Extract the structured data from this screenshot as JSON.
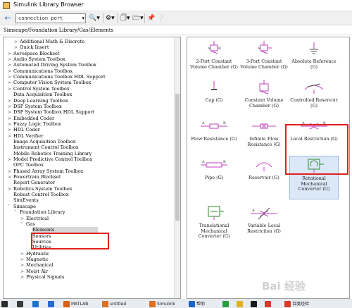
{
  "window": {
    "title": "Simulink Library Browser",
    "icon": "simulink-icon"
  },
  "toolbar": {
    "search_value": "connection port",
    "back_icon": "back-arrow-icon",
    "search_dropdown_icon": "chevron-down-icon",
    "find_icon": "binoculars-icon",
    "options_icon": "gear-icon",
    "new_icon": "new-model-icon",
    "open_icon": "folder-open-icon",
    "pin_icon": "pin-icon",
    "help_icon": "help-icon"
  },
  "breadcrumb": "Simscape/Foundation Library/Gas/Elements",
  "tree": [
    {
      "label": "Additional Math & Discrete",
      "indent": 1,
      "arrow": ">"
    },
    {
      "label": "Quick Insert",
      "indent": 1,
      "arrow": ">"
    },
    {
      "label": "Aerospace Blockset",
      "indent": 0,
      "arrow": ">"
    },
    {
      "label": "Audio System Toolbox",
      "indent": 0,
      "arrow": ">"
    },
    {
      "label": "Automated Driving System Toolbox",
      "indent": 0,
      "arrow": ">"
    },
    {
      "label": "Communications Toolbox",
      "indent": 0,
      "arrow": ">"
    },
    {
      "label": "Communications Toolbox HDL Support",
      "indent": 0,
      "arrow": ">"
    },
    {
      "label": "Computer Vision System Toolbox",
      "indent": 0,
      "arrow": ">"
    },
    {
      "label": "Control System Toolbox",
      "indent": 0,
      "arrow": ">"
    },
    {
      "label": "Data Acquisition Toolbox",
      "indent": 0,
      "arrow": ""
    },
    {
      "label": "Deep Learning Toolbox",
      "indent": 0,
      "arrow": ">"
    },
    {
      "label": "DSP System Toolbox",
      "indent": 0,
      "arrow": ">"
    },
    {
      "label": "DSP System Toolbox HDL Support",
      "indent": 0,
      "arrow": ">"
    },
    {
      "label": "Embedded Coder",
      "indent": 0,
      "arrow": ">"
    },
    {
      "label": "Fuzzy Logic Toolbox",
      "indent": 0,
      "arrow": ">"
    },
    {
      "label": "HDL Coder",
      "indent": 0,
      "arrow": ">"
    },
    {
      "label": "HDL Verifier",
      "indent": 0,
      "arrow": ">"
    },
    {
      "label": "Image Acquisition Toolbox",
      "indent": 0,
      "arrow": ""
    },
    {
      "label": "Instrument Control Toolbox",
      "indent": 0,
      "arrow": ""
    },
    {
      "label": "Mobile Robotics Training Library",
      "indent": 0,
      "arrow": ""
    },
    {
      "label": "Model Predictive Control Toolbox",
      "indent": 0,
      "arrow": ">"
    },
    {
      "label": "OPC Toolbox",
      "indent": 0,
      "arrow": ""
    },
    {
      "label": "Phased Array System Toolbox",
      "indent": 0,
      "arrow": ">"
    },
    {
      "label": "Powertrain Blockset",
      "indent": 0,
      "arrow": ">"
    },
    {
      "label": "Report Generator",
      "indent": 0,
      "arrow": ""
    },
    {
      "label": "Robotics System Toolbox",
      "indent": 0,
      "arrow": ">"
    },
    {
      "label": "Robust Control Toolbox",
      "indent": 0,
      "arrow": ""
    },
    {
      "label": "SimEvents",
      "indent": 0,
      "arrow": ""
    },
    {
      "label": "Simscape",
      "indent": 0,
      "arrow": "v"
    },
    {
      "label": "Foundation Library",
      "indent": 1,
      "arrow": "v"
    },
    {
      "label": "Electrical",
      "indent": 2,
      "arrow": ">"
    },
    {
      "label": "Gas",
      "indent": 2,
      "arrow": "v"
    },
    {
      "label": "Elements",
      "indent": 3,
      "arrow": "",
      "selected": true
    },
    {
      "label": "Sensors",
      "indent": 3,
      "arrow": ""
    },
    {
      "label": "Sources",
      "indent": 3,
      "arrow": ""
    },
    {
      "label": "Utilities",
      "indent": 3,
      "arrow": ""
    },
    {
      "label": "Hydraulic",
      "indent": 2,
      "arrow": ">"
    },
    {
      "label": "Magnetic",
      "indent": 2,
      "arrow": ">"
    },
    {
      "label": "Mechanical",
      "indent": 2,
      "arrow": ">"
    },
    {
      "label": "Moist Air",
      "indent": 2,
      "arrow": ">"
    },
    {
      "label": "Physical Signals",
      "indent": 2,
      "arrow": ">"
    }
  ],
  "blocks": [
    {
      "label": "2-Port Constant Volume Chamber (G)",
      "icon": "two-port-chamber-icon"
    },
    {
      "label": "3-Port Constant Volume Chamber (G)",
      "icon": "three-port-chamber-icon"
    },
    {
      "label": "Absolute Reference (G)",
      "icon": "absolute-reference-icon"
    },
    {
      "label": "Cap (G)",
      "icon": "cap-icon"
    },
    {
      "label": "Constant Volume Chamber (G)",
      "icon": "chamber-icon"
    },
    {
      "label": "Controlled Reservoir (G)",
      "icon": "controlled-reservoir-icon"
    },
    {
      "label": "Flow Resistance (G)",
      "icon": "flow-resistance-icon"
    },
    {
      "label": "Infinite Flow Resistance (G)",
      "icon": "infinite-flow-resistance-icon"
    },
    {
      "label": "Local Restriction (G)",
      "icon": "local-restriction-icon"
    },
    {
      "label": "Pipe (G)",
      "icon": "pipe-icon"
    },
    {
      "label": "Reservoir (G)",
      "icon": "reservoir-icon"
    },
    {
      "label": "Rotational Mechanical Converter (G)",
      "icon": "rotational-converter-icon",
      "highlighted": true
    },
    {
      "label": "Translational Mechanical Converter (G)",
      "icon": "translational-converter-icon"
    },
    {
      "label": "Variable Local Restriction (G)",
      "icon": "variable-restriction-icon"
    }
  ],
  "taskbar": [
    {
      "label": "",
      "icon": "start-icon",
      "color": "#2b2b2b"
    },
    {
      "label": "",
      "icon": "search-icon",
      "color": "#3a3a3a"
    },
    {
      "label": "",
      "icon": "edge-icon",
      "color": "#1e74c8"
    },
    {
      "label": "",
      "icon": "cs-icon",
      "color": "#2a6bd0"
    },
    {
      "label": "MATLAB",
      "icon": "matlab-icon",
      "color": "#d86018"
    },
    {
      "label": "untitled",
      "icon": "simulink-icon",
      "color": "#e07020"
    },
    {
      "label": "Simulink",
      "icon": "simulink-icon",
      "color": "#e07020"
    },
    {
      "label": "帮助",
      "icon": "help-icon",
      "color": "#1e64c8"
    },
    {
      "label": "",
      "icon": "app-icon",
      "color": "#2a9d40"
    },
    {
      "label": "",
      "icon": "app-icon",
      "color": "#e0b020"
    },
    {
      "label": "",
      "icon": "qq-icon",
      "color": "#1a1a1a"
    },
    {
      "label": "",
      "icon": "chrome-icon",
      "color": "#d83a2a"
    },
    {
      "label": "百度经验",
      "icon": "baidu-icon",
      "color": "#d83a2a"
    }
  ],
  "watermark": "Bai 经验"
}
